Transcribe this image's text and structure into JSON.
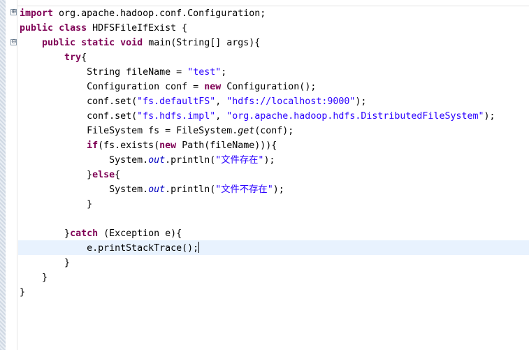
{
  "editor": {
    "fold": {
      "expanded": "⊕",
      "collapsed": "⊖"
    },
    "code": {
      "l1": {
        "kw": "import",
        "rest": " org.apache.hadoop.conf.Configuration;"
      },
      "l2": {
        "kw1": "public",
        "kw2": "class",
        "rest": " HDFSFileIfExist {"
      },
      "l3": {
        "kw1": "public",
        "kw2": "static",
        "kw3": "void",
        "rest": " main(String[] args){"
      },
      "l4": {
        "kw": "try",
        "rest": "{"
      },
      "l5": {
        "pre": "String fileName = ",
        "str": "\"test\"",
        "post": ";"
      },
      "l6": {
        "pre": "Configuration conf = ",
        "kw": "new",
        "post": " Configuration();"
      },
      "l7": {
        "pre": "conf.set(",
        "s1": "\"fs.defaultFS\"",
        "mid": ", ",
        "s2": "\"hdfs://localhost:9000\"",
        "post": ");"
      },
      "l8": {
        "pre": "conf.set(",
        "s1": "\"fs.hdfs.impl\"",
        "mid": ", ",
        "s2": "\"org.apache.hadoop.hdfs.DistributedFileSystem\"",
        "post": ");"
      },
      "l9": {
        "pre": "FileSystem fs = FileSystem.",
        "sm": "get",
        "post": "(conf);"
      },
      "l10": {
        "kw1": "if",
        "mid1": "(fs.exists(",
        "kw2": "new",
        "post": " Path(fileName))){"
      },
      "l11": {
        "pre": "System.",
        "fld": "out",
        "mid": ".println(",
        "str": "\"文件存在\"",
        "post": ");"
      },
      "l12": {
        "pre": "}",
        "kw": "else",
        "post": "{"
      },
      "l13": {
        "pre": "System.",
        "fld": "out",
        "mid": ".println(",
        "str": "\"文件不存在\"",
        "post": ");"
      },
      "l14": {
        "text": "}"
      },
      "l15": {
        "text": ""
      },
      "l16": {
        "pre": "}",
        "kw": "catch",
        "post": " (Exception e){"
      },
      "l17": {
        "text": "e.printStackTrace();"
      },
      "l18": {
        "text": "}"
      },
      "l19": {
        "text": "}"
      },
      "l20": {
        "text": "}"
      }
    }
  }
}
